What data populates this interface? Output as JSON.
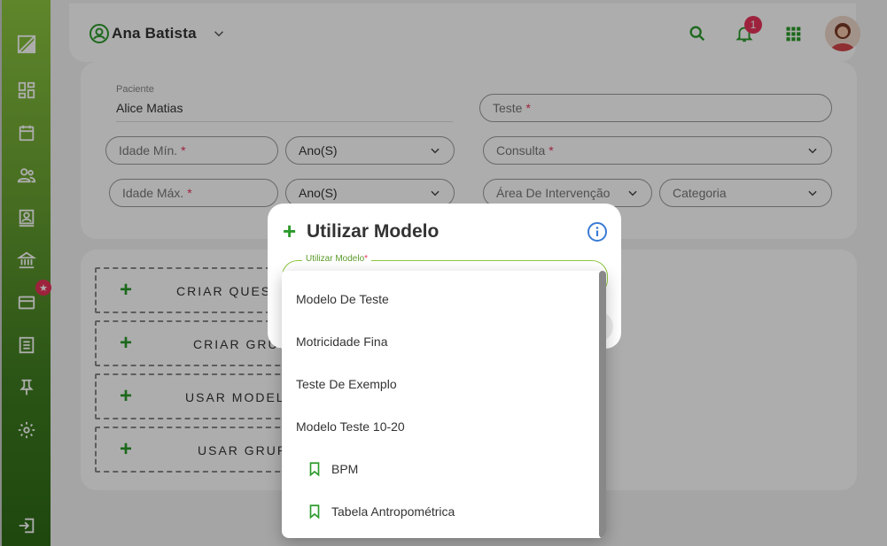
{
  "header": {
    "user_name": "Ana Batista",
    "notification_count": "1"
  },
  "form": {
    "paciente_label": "Paciente",
    "paciente_value": "Alice Matias",
    "teste_label": "Teste",
    "idade_min_label": "Idade Mín.",
    "idade_max_label": "Idade Máx.",
    "ano_min_value": "Ano(S)",
    "ano_max_value": "Ano(S)",
    "consulta_label": "Consulta",
    "area_label": "Área De Intervenção",
    "categoria_label": "Categoria",
    "required_mark": "*"
  },
  "actions": {
    "criar_questao": "CRIAR QUEST",
    "criar_grupo": "CRIAR GRUP",
    "usar_modelo": "USAR MODELO",
    "usar_grupo": "USAR GRUPO"
  },
  "sidebar": {
    "badge": "★"
  },
  "modal": {
    "title": "Utilizar Modelo",
    "field_label": "Utilizar Modelo",
    "field_required": "*"
  },
  "dropdown": {
    "items": [
      {
        "label": "Modelo De Teste"
      },
      {
        "label": "Motricidade Fina"
      },
      {
        "label": "Teste De Exemplo"
      },
      {
        "label": "Modelo Teste 10-20"
      },
      {
        "label": "BPM"
      },
      {
        "label": "Tabela Antropométrica"
      }
    ]
  },
  "colors": {
    "brand_green": "#2a9a2a",
    "accent_green": "#8cc63f",
    "badge_red": "#e8345a",
    "info_blue": "#3a7bd5"
  }
}
